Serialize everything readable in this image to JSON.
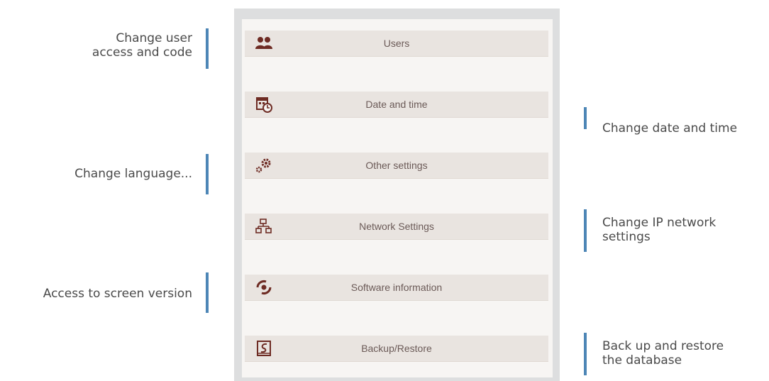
{
  "menu": {
    "items": [
      {
        "label": "Users",
        "icon": "users-icon"
      },
      {
        "label": "Date and time",
        "icon": "calendar-clock-icon"
      },
      {
        "label": "Other settings",
        "icon": "gears-icon"
      },
      {
        "label": "Network Settings",
        "icon": "network-icon"
      },
      {
        "label": "Software information",
        "icon": "software-info-icon"
      },
      {
        "label": "Backup/Restore",
        "icon": "backup-icon"
      }
    ]
  },
  "annotations": {
    "users": "Change user\naccess and code",
    "date_time": "Change date and time",
    "other_settings": "Change language...",
    "network": "Change IP network\nsettings",
    "software": "Access to screen version",
    "backup": "Back up and restore\nthe database"
  },
  "colors": {
    "accent_bar": "#4d86b6",
    "icon": "#6e2b23",
    "menu_item_bg": "#e9e4e0",
    "label": "#6b5a57"
  }
}
